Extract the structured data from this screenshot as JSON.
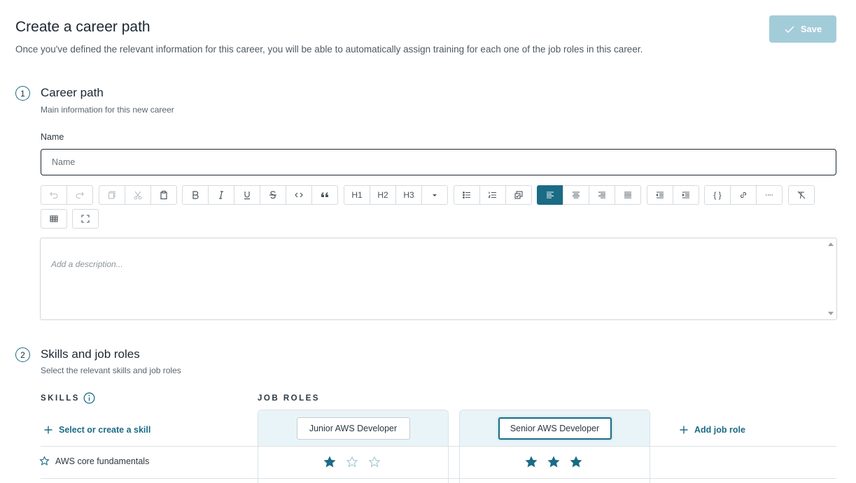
{
  "header": {
    "title": "Create a career path",
    "subtitle": "Once you've defined the relevant information for this career, you will be able to automatically assign training for each one of the job roles in this career.",
    "save_label": "Save"
  },
  "section1": {
    "number": "1",
    "title": "Career path",
    "subtitle": "Main information for this new career",
    "name_label": "Name",
    "name_placeholder": "Name",
    "description_placeholder": "Add a description..."
  },
  "toolbar": {
    "h1": "H1",
    "h2": "H2",
    "h3": "H3",
    "code_block": "{ }",
    "icons": [
      "undo-icon",
      "redo-icon",
      "copy-icon",
      "cut-icon",
      "paste-icon",
      "bold-icon",
      "italic-icon",
      "underline-icon",
      "strikethrough-icon",
      "code-icon",
      "quote-icon",
      "heading-dropdown-icon",
      "bullet-list-icon",
      "numbered-list-icon",
      "task-list-icon",
      "align-left-icon",
      "align-center-icon",
      "align-right-icon",
      "align-justify-icon",
      "outdent-icon",
      "indent-icon",
      "link-icon",
      "horizontal-rule-icon",
      "clear-format-icon",
      "table-icon",
      "fullscreen-icon"
    ]
  },
  "section2": {
    "number": "2",
    "title": "Skills and job roles",
    "subtitle": "Select the relevant skills and job roles",
    "skills_header": "SKILLS",
    "roles_header": "JOB ROLES",
    "select_skill_label": "Select or create a skill",
    "add_role_label": "Add job role",
    "roles": [
      {
        "name": "Junior AWS Developer"
      },
      {
        "name": "Senior AWS Developer"
      }
    ],
    "skills": [
      {
        "name": "AWS core fundamentals",
        "levels": [
          1,
          3
        ],
        "max": 3
      }
    ]
  },
  "colors": {
    "accent": "#1b6b85",
    "save_disabled": "#a3ccd9",
    "role_header_bg": "#e9f4f8"
  }
}
